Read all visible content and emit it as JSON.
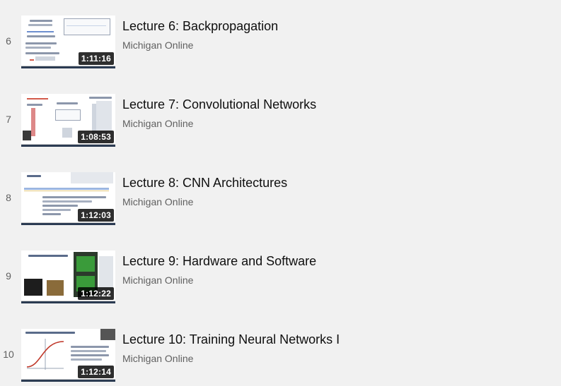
{
  "playlist": {
    "items": [
      {
        "index": "6",
        "title": "Lecture 6: Backpropagation",
        "channel": "Michigan Online",
        "duration": "1:11:16"
      },
      {
        "index": "7",
        "title": "Lecture 7: Convolutional Networks",
        "channel": "Michigan Online",
        "duration": "1:08:53"
      },
      {
        "index": "8",
        "title": "Lecture 8: CNN Architectures",
        "channel": "Michigan Online",
        "duration": "1:12:03"
      },
      {
        "index": "9",
        "title": "Lecture 9: Hardware and Software",
        "channel": "Michigan Online",
        "duration": "1:12:22"
      },
      {
        "index": "10",
        "title": "Lecture 10: Training Neural Networks I",
        "channel": "Michigan Online",
        "duration": "1:12:14"
      }
    ]
  },
  "colors": {
    "background": "#f1f1f1",
    "title_text": "#0f0f0f",
    "secondary_text": "#606060",
    "duration_badge": "#000000"
  }
}
